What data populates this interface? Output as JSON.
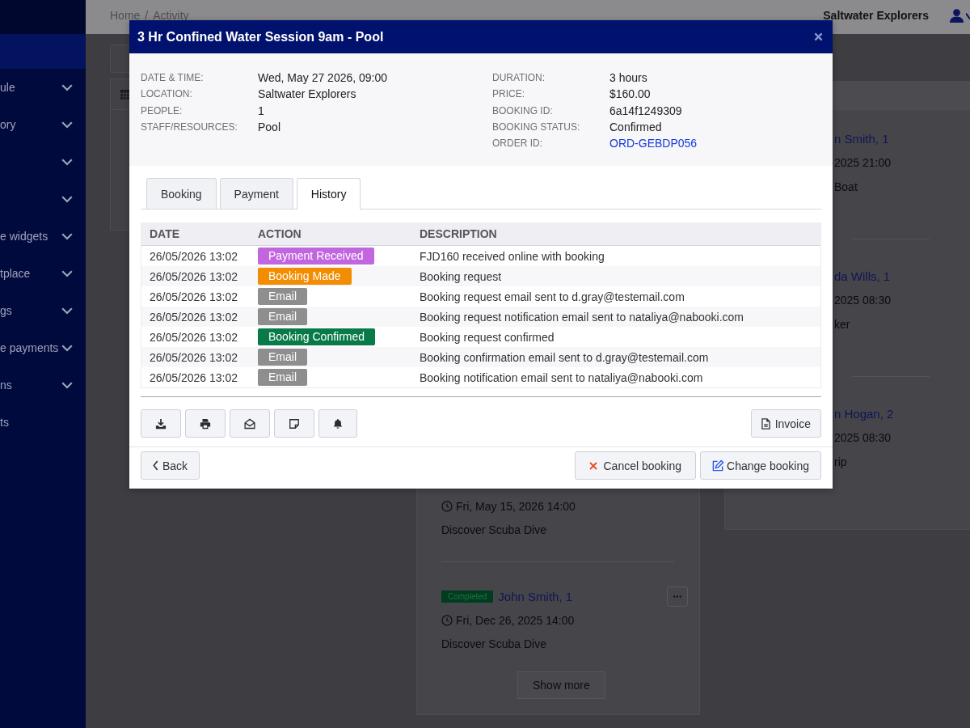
{
  "header": {
    "breadcrumb": {
      "items": [
        "Home",
        "Activity"
      ],
      "separator": "/"
    },
    "account": "Saltwater Explorers"
  },
  "sidebar": {
    "items": [
      {
        "kind": "link",
        "selected": true
      },
      {
        "label": "ule",
        "kind": "group",
        "selected": false
      },
      {
        "label": "ory",
        "kind": "group",
        "selected": false
      },
      {
        "kind": "group",
        "selected": false
      },
      {
        "kind": "group",
        "selected": false
      },
      {
        "label": "e widgets",
        "kind": "group",
        "selected": false
      },
      {
        "label": "tplace",
        "kind": "group",
        "selected": false
      },
      {
        "label": "gs",
        "kind": "group",
        "selected": false
      },
      {
        "label": "e payments",
        "kind": "group",
        "selected": false
      },
      {
        "label": "ns",
        "kind": "group",
        "selected": false
      },
      {
        "label": "ts",
        "kind": "link",
        "selected": false
      }
    ]
  },
  "modal": {
    "title": "3 Hr Confined Water Session 9am - Pool",
    "details_left": [
      {
        "label": "DATE & TIME:",
        "value": "Wed, May 27 2026, 09:00",
        "kind": "text"
      },
      {
        "label": "LOCATION:",
        "value": "Saltwater Explorers",
        "kind": "text"
      },
      {
        "label": "PEOPLE:",
        "value": "1",
        "kind": "text"
      },
      {
        "label": "STAFF/RESOURCES:",
        "value": "Pool",
        "kind": "text"
      }
    ],
    "details_right": [
      {
        "label": "DURATION:",
        "value": "3 hours",
        "kind": "text"
      },
      {
        "label": "PRICE:",
        "value": "$160.00",
        "kind": "text"
      },
      {
        "label": "BOOKING ID:",
        "value": "6a14f1249309",
        "kind": "text"
      },
      {
        "label": "BOOKING STATUS:",
        "value": "Confirmed",
        "kind": "text"
      },
      {
        "label": "ORDER ID:",
        "value": "ORD-GEBDP056",
        "kind": "link"
      }
    ],
    "tabs": [
      {
        "label": "Booking",
        "selected": false
      },
      {
        "label": "Payment",
        "selected": false
      },
      {
        "label": "History",
        "selected": true
      }
    ],
    "history": {
      "columns": [
        "DATE",
        "ACTION",
        "DESCRIPTION"
      ],
      "rows": [
        {
          "date": "26/05/2026 13:02",
          "action": {
            "label": "Payment Received",
            "color": "#c266e0"
          },
          "description": "FJD160 received online with booking"
        },
        {
          "date": "26/05/2026 13:02",
          "action": {
            "label": "Booking Made",
            "color": "#f28c00"
          },
          "description": "Booking request"
        },
        {
          "date": "26/05/2026 13:02",
          "action": {
            "label": "Email",
            "color": "#8e8e8e"
          },
          "description": "Booking request email sent to d.gray@testemail.com"
        },
        {
          "date": "26/05/2026 13:02",
          "action": {
            "label": "Email",
            "color": "#8e8e8e"
          },
          "description": "Booking request notification email sent to nataliya@nabooki.com"
        },
        {
          "date": "26/05/2026 13:02",
          "action": {
            "label": "Booking Confirmed",
            "color": "#077a47"
          },
          "description": "Booking request confirmed"
        },
        {
          "date": "26/05/2026 13:02",
          "action": {
            "label": "Email",
            "color": "#8e8e8e"
          },
          "description": "Booking confirmation email sent to d.gray@testemail.com"
        },
        {
          "date": "26/05/2026 13:02",
          "action": {
            "label": "Email",
            "color": "#8e8e8e"
          },
          "description": "Booking notification email sent to nataliya@nabooki.com"
        }
      ]
    },
    "invoice_button": "Invoice",
    "back_button": "Back",
    "cancel_button": "Cancel booking",
    "change_button": "Change booking"
  },
  "activity_feed": {
    "entries": [
      {
        "time": "Fri, May 15, 2026 14:00",
        "activity": "Discover Scuba Dive"
      },
      {
        "status": "Completed",
        "name": "John Smith, 1",
        "time": "Fri, Dec 26, 2025 14:00",
        "activity": "Discover Scuba Dive"
      }
    ],
    "show_more": "Show more"
  },
  "side_list": {
    "entries": [
      {
        "name": "n Smith, 1",
        "time": "2025 21:00",
        "activity": "Boat"
      },
      {
        "name": "da Wills, 1",
        "time": "2025 08:30",
        "activity": "ker"
      },
      {
        "name": "n Hogan, 2",
        "time": "2025 08:30",
        "activity": "rip"
      }
    ]
  }
}
